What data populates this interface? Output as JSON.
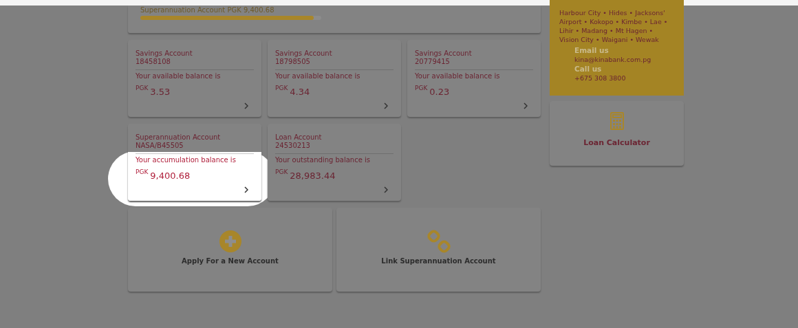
{
  "summary_card": {
    "label": "Superannuation Account  PGK 9,400.68",
    "level": 0.96
  },
  "accounts": [
    {
      "type": "Savings Account",
      "number": "18458108",
      "caption": "Your available balance is",
      "currency": "PGK",
      "amount": "3.53",
      "spotlight": false
    },
    {
      "type": "Savings Account",
      "number": "18798505",
      "caption": "Your available balance is",
      "currency": "PGK",
      "amount": "4.34",
      "spotlight": false
    },
    {
      "type": "Savings Account",
      "number": "20779415",
      "caption": "Your available balance is",
      "currency": "PGK",
      "amount": "0.23",
      "spotlight": false
    },
    {
      "type": "Superannuation Account",
      "number": "NASA/B45505",
      "caption": "Your accumulation balance is",
      "currency": "PGK",
      "amount": "9,400.68",
      "spotlight": true
    },
    {
      "type": "Loan Account",
      "number": "24530213",
      "caption": "Your outstanding balance is",
      "currency": "PGK",
      "amount": "28,983.44",
      "spotlight": false
    }
  ],
  "actions": [
    {
      "kind": "add",
      "label": "Apply For a New Account"
    },
    {
      "kind": "link",
      "label": "Link Superannuation Account"
    }
  ],
  "contact_panel": {
    "branches": "Harbour City • Hides • Jacksons' Airport • Kokopo • Kimbe • Lae • Lihir • Madang • Mt Hagen • Vision City • Waigani • Wewak",
    "email_heading": "Email us",
    "email": "kina@kinabank.com.pg",
    "phone_heading": "Call us",
    "phone": "+675 308 3800"
  },
  "loan_calculator": {
    "label": "Loan Calculator"
  }
}
